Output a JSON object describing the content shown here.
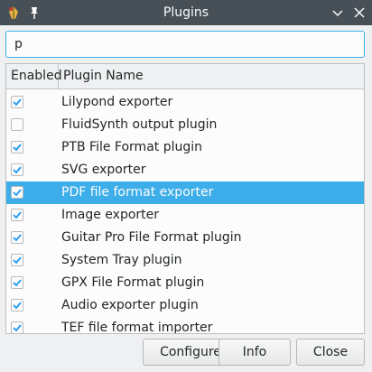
{
  "window": {
    "title": "Plugins"
  },
  "search": {
    "value": "p"
  },
  "table": {
    "columns": [
      "Enabled",
      "Plugin Name"
    ],
    "rows": [
      {
        "name": "Lilypond exporter",
        "enabled": true,
        "selected": false
      },
      {
        "name": "FluidSynth output plugin",
        "enabled": false,
        "selected": false
      },
      {
        "name": "PTB File Format plugin",
        "enabled": true,
        "selected": false
      },
      {
        "name": "SVG exporter",
        "enabled": true,
        "selected": false
      },
      {
        "name": "PDF file format exporter",
        "enabled": true,
        "selected": true
      },
      {
        "name": "Image exporter",
        "enabled": true,
        "selected": false
      },
      {
        "name": "Guitar Pro File Format plugin",
        "enabled": true,
        "selected": false
      },
      {
        "name": "System Tray plugin",
        "enabled": true,
        "selected": false
      },
      {
        "name": "GPX File Format plugin",
        "enabled": true,
        "selected": false
      },
      {
        "name": "Audio exporter plugin",
        "enabled": true,
        "selected": false
      },
      {
        "name": "TEF file format importer",
        "enabled": true,
        "selected": false
      }
    ]
  },
  "buttons": {
    "configure": "Configure",
    "info": "Info",
    "close": "Close"
  },
  "colors": {
    "titlebar": "#475057",
    "selection": "#3daee9",
    "check": "#1d99f3"
  }
}
